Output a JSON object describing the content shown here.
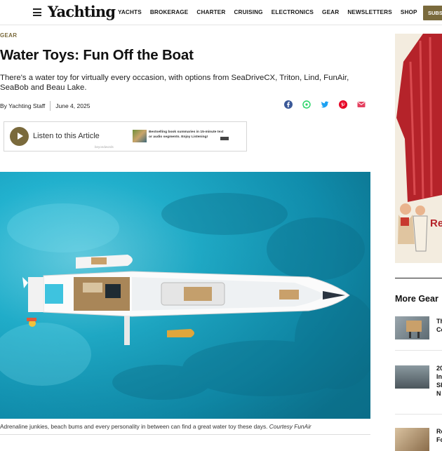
{
  "header": {
    "logo": "Yachting",
    "nav": [
      "YACHTS",
      "BROKERAGE",
      "CHARTER",
      "CRUISING",
      "ELECTRONICS",
      "GEAR",
      "NEWSLETTERS",
      "SHOP"
    ],
    "subscribe_label": "SUBS"
  },
  "article": {
    "category": "GEAR",
    "title": "Water Toys: Fun Off the Boat",
    "dek": "There's a water toy for virtually every occasion, with options from SeaDriveCX, Triton, Lind, FunAir, SeaBob and Beau Lake.",
    "author": "By Yachting Staff",
    "date": "June 4, 2025",
    "share_icons": [
      "facebook-icon",
      "whatsapp-icon",
      "twitter-icon",
      "pinterest-icon",
      "email-icon"
    ],
    "share_colors": {
      "facebook": "#3b5998",
      "whatsapp": "#25d366",
      "twitter": "#1da1f2",
      "pinterest": "#e60023",
      "email": "#e4405f"
    }
  },
  "player": {
    "listen_label": "Listen to this Article",
    "badge": "beyondwords",
    "promo_text": "Bestselling book summaries in 15-minute text or audio segments. Enjoy Listening!"
  },
  "hero": {
    "caption": "Adrenaline junkies, beach bums and every personality in between can find a great water toy these days.",
    "credit": "Courtesy FunAir"
  },
  "sidebar": {
    "ad_text": "Re",
    "more_heading": "More Gear",
    "items": [
      {
        "lines": [
          "Th",
          "Co"
        ]
      },
      {
        "lines": [
          "20",
          "In",
          "Sh",
          "N"
        ]
      },
      {
        "lines": [
          "Re",
          "Fo"
        ]
      }
    ]
  },
  "colors": {
    "accent": "#7a6a3c",
    "water": "#19a6c6"
  }
}
